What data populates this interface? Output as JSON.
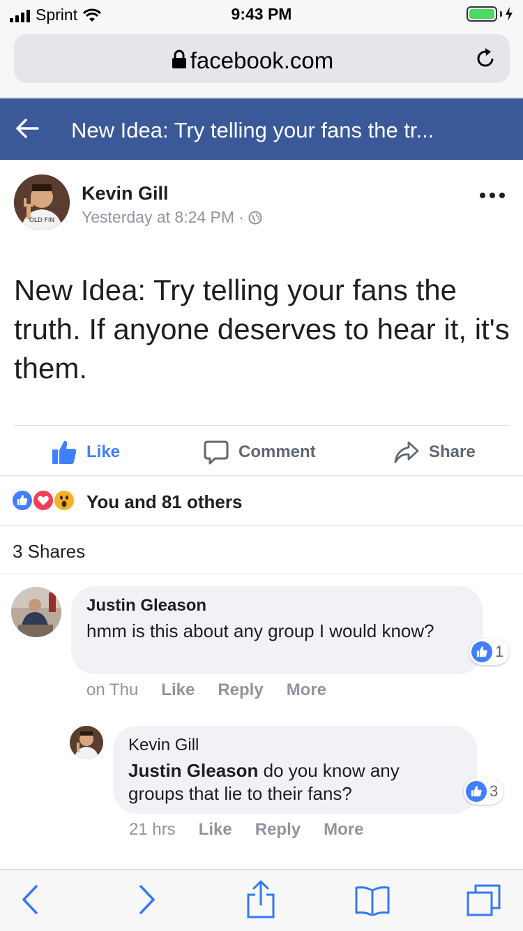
{
  "status_bar": {
    "carrier": "Sprint",
    "time": "9:43 PM",
    "battery_color": "#4cd964"
  },
  "browser": {
    "url": "facebook.com",
    "icons": [
      "lock-icon",
      "reload-icon"
    ]
  },
  "fb_header": {
    "title": "New Idea: Try telling your fans the tr...",
    "bg_color": "#3b5998",
    "back_icon": "back-arrow-icon"
  },
  "post": {
    "author": "Kevin Gill",
    "timestamp": "Yesterday at 8:24 PM",
    "separator": "·",
    "privacy_icon": "globe-icon",
    "text": "New Idea: Try telling your fans the truth. If anyone deserves to hear it, it's them."
  },
  "actions": {
    "like": "Like",
    "comment": "Comment",
    "share": "Share",
    "like_color": "#4080ff"
  },
  "reactions": {
    "icons": [
      "like-reaction-icon",
      "love-reaction-icon",
      "wow-reaction-icon"
    ],
    "summary": "You and 81 others"
  },
  "shares": {
    "text": "3 Shares"
  },
  "comments": [
    {
      "author": "Justin Gleason",
      "text": "hmm is this about any group I would know?",
      "time": "on Thu",
      "like": "Like",
      "reply": "Reply",
      "more": "More",
      "likes": "1"
    },
    {
      "author": "Kevin Gill",
      "mention": "Justin Gleason",
      "text": " do you know any groups that lie to their fans?",
      "time": "21 hrs",
      "like": "Like",
      "reply": "Reply",
      "more": "More",
      "likes": "3"
    }
  ],
  "toolbar": {
    "icons": [
      "back-icon",
      "forward-icon",
      "share-icon",
      "bookmarks-icon",
      "tabs-icon"
    ],
    "tint": "#3478f6"
  }
}
